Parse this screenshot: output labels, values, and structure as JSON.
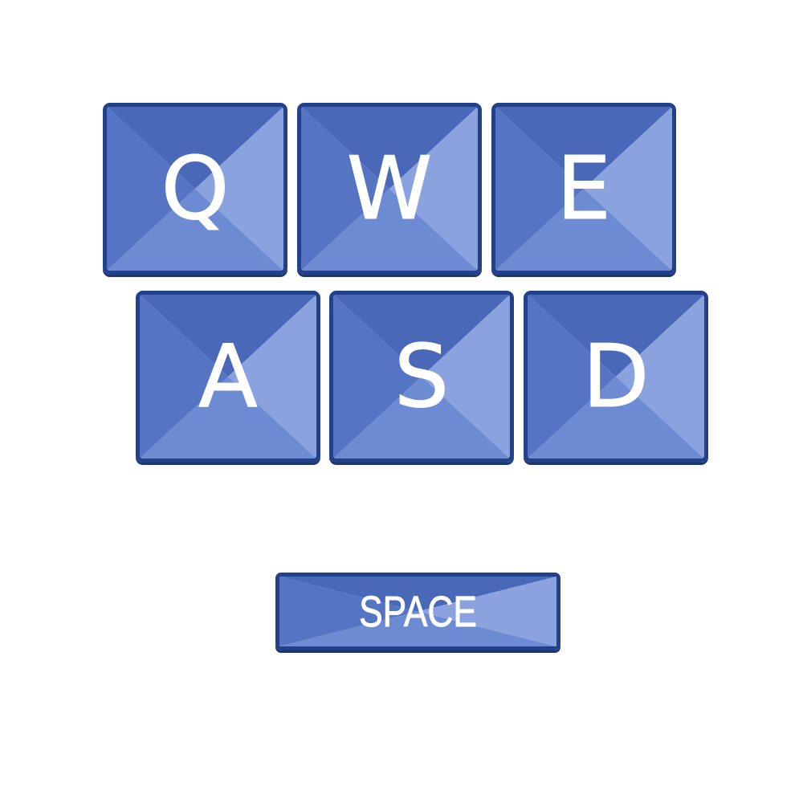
{
  "keyboard": {
    "row1": [
      {
        "label": "Q"
      },
      {
        "label": "W"
      },
      {
        "label": "E"
      }
    ],
    "row2": [
      {
        "label": "A"
      },
      {
        "label": "S"
      },
      {
        "label": "D"
      }
    ],
    "space": {
      "label": "SPACE"
    }
  },
  "colors": {
    "key_border": "#22418a",
    "key_top": "#4a68b8",
    "key_left": "#5575c4",
    "key_right": "#8aa3de",
    "key_bottom": "#6d8bd2",
    "label": "#ffffff",
    "background": "#ffffff"
  }
}
